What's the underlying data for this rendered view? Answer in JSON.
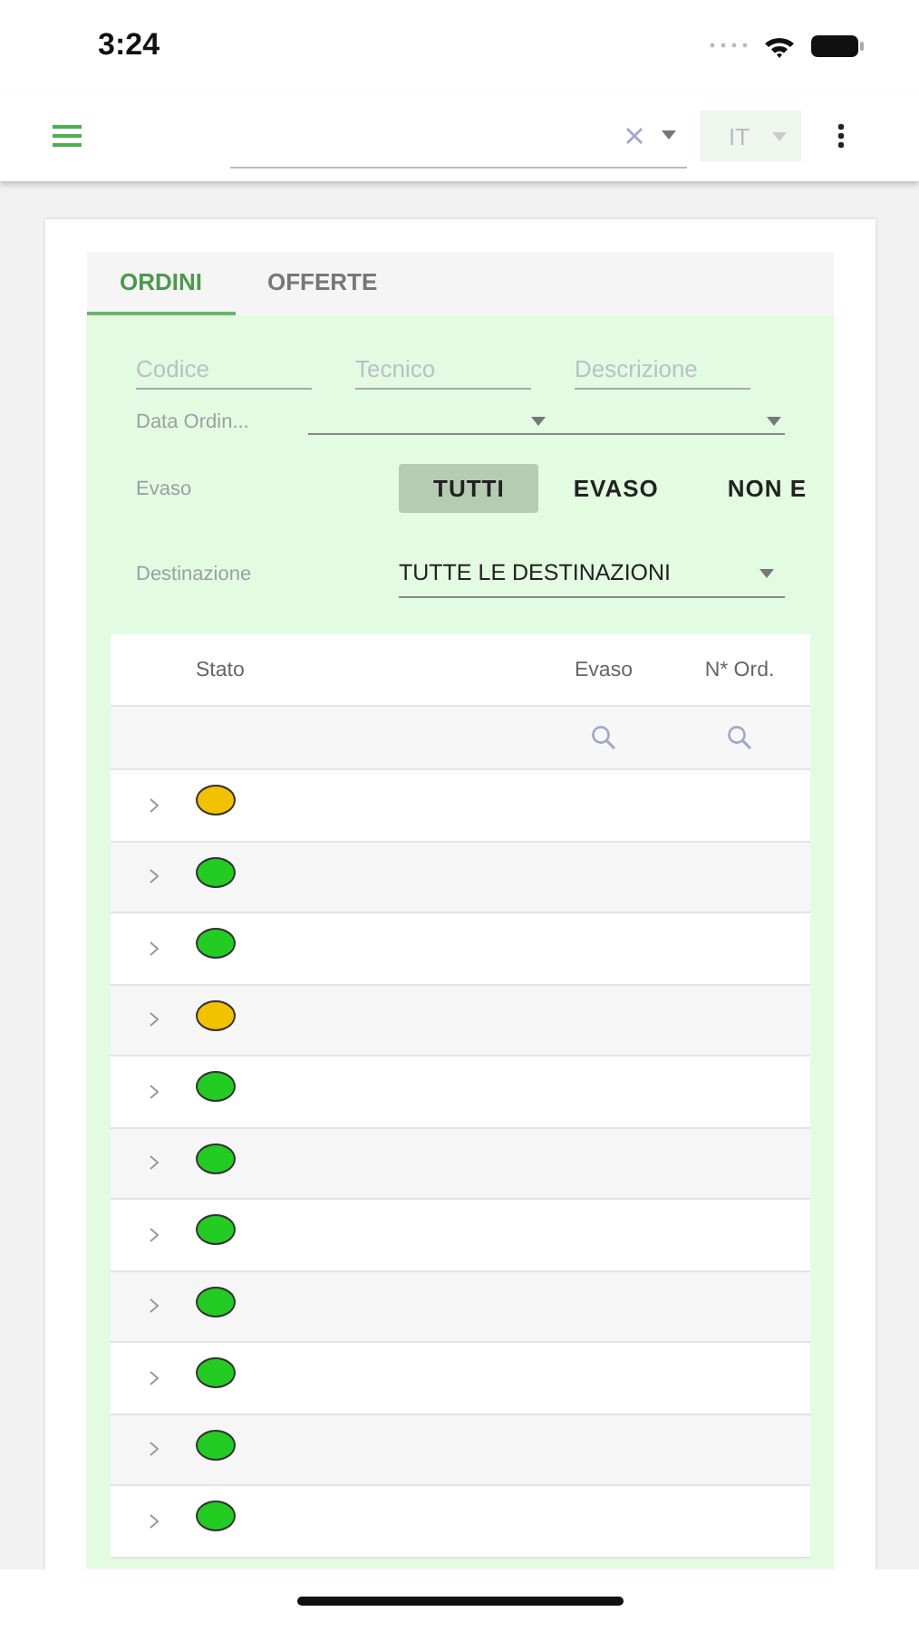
{
  "status_bar": {
    "time": "3:24"
  },
  "toolbar": {
    "language": "IT"
  },
  "tabs": [
    {
      "label": "ORDINI",
      "selected": true
    },
    {
      "label": "OFFERTE",
      "selected": false
    }
  ],
  "filters": {
    "fields": [
      {
        "placeholder": "Codice"
      },
      {
        "placeholder": "Tecnico"
      },
      {
        "placeholder": "Descrizione"
      }
    ],
    "date_label": "Data Ordin...",
    "evaso_label": "Evaso",
    "evaso_options": [
      {
        "label": "TUTTI",
        "selected": true
      },
      {
        "label": "EVASO",
        "selected": false
      },
      {
        "label": "NON E",
        "selected": false
      }
    ],
    "destination_label": "Destinazione",
    "destination_value": "TUTTE LE DESTINAZIONI"
  },
  "table": {
    "columns": [
      "Stato",
      "Evaso",
      "N* Ord."
    ],
    "rows": [
      {
        "color": "#f2c200"
      },
      {
        "color": "#22cc22"
      },
      {
        "color": "#22cc22"
      },
      {
        "color": "#f2c200"
      },
      {
        "color": "#22cc22"
      },
      {
        "color": "#22cc22"
      },
      {
        "color": "#22cc22"
      },
      {
        "color": "#22cc22"
      },
      {
        "color": "#22cc22"
      },
      {
        "color": "#22cc22"
      },
      {
        "color": "#22cc22"
      }
    ]
  }
}
